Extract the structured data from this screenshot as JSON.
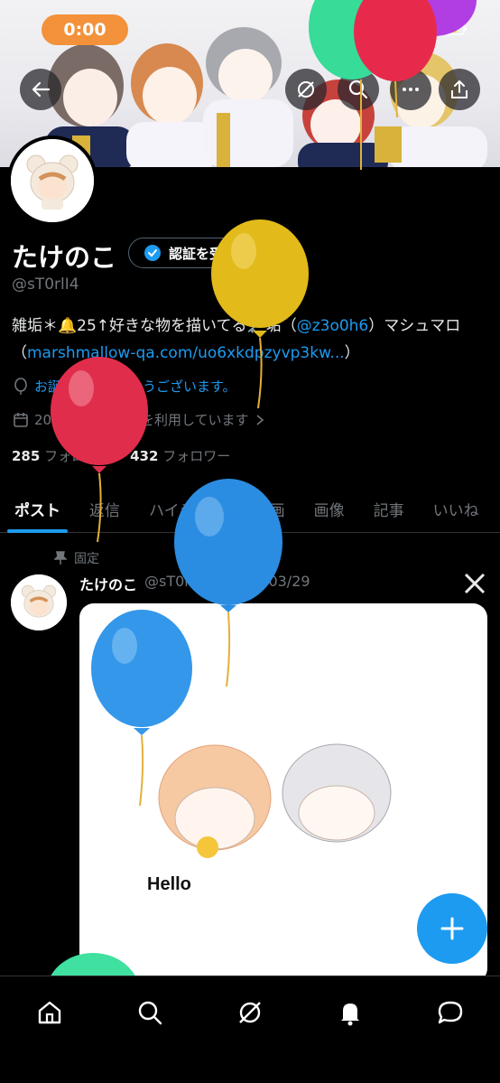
{
  "status_bar": {
    "time": "0:00"
  },
  "profile": {
    "display_name": "たけのこ",
    "verify_label": "認証を受ける",
    "handle": "@sT0rlI4",
    "bio_prefix": "雑垢＊🔔25↑好きな物を描いてる🗝️垢（",
    "bio_mention": "@z3o0h6",
    "bio_mid": "）マシュマロ（",
    "bio_link": "marshmallow-qa.com/uo6xkdpzyvp3kw...",
    "bio_suffix": "）",
    "birthday_prefix": "お誕生日おめで",
    "birthday_suffix": "とうございます。",
    "joined": "2023年1月からXを利用しています",
    "following_count": "285",
    "following_label": "フォロー中",
    "followers_count": "432",
    "followers_label": "フォロワー"
  },
  "tabs": [
    {
      "label": "ポスト",
      "active": true
    },
    {
      "label": "返信"
    },
    {
      "label": "ハイライト"
    },
    {
      "label": "動画"
    },
    {
      "label": "画像"
    },
    {
      "label": "記事"
    },
    {
      "label": "いいね"
    }
  ],
  "post": {
    "pinned_label": "固定",
    "author_name": "たけのこ",
    "author_handle": "@sT0rlI4",
    "date": "2026/03/29",
    "image_text": "Hello"
  },
  "icons": {
    "back": "arrow-left-icon",
    "grok": "grok-icon",
    "search": "search-icon",
    "more": "more-icon",
    "share": "share-icon",
    "home": "home-icon",
    "notifications": "bell-icon",
    "messages": "message-icon",
    "compose": "plus-icon"
  },
  "colors": {
    "accent": "#1d9bf0",
    "time_pill": "#f3923a",
    "balloon_yellow": "#e8c21f",
    "balloon_red": "#e3344c",
    "balloon_blue": "#2f8fe0",
    "balloon_green": "#3fe0a0",
    "balloon_purple": "#b53de0"
  }
}
